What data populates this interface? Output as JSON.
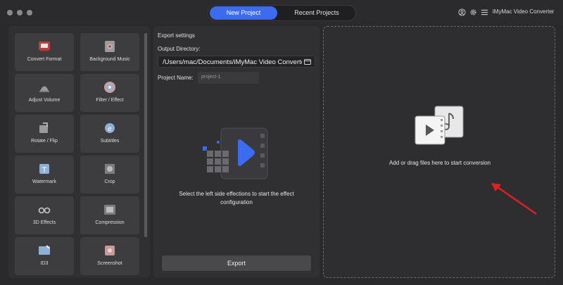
{
  "window": {
    "app_name": "iMyMac Video Converter",
    "tabs": [
      {
        "label": "New Project",
        "active": true
      },
      {
        "label": "Recent Projects",
        "active": false
      }
    ],
    "accent_color": "#3b6cf0"
  },
  "tools": [
    {
      "label": "Convert Format",
      "icon": "convert-format-icon"
    },
    {
      "label": "Background Music",
      "icon": "background-music-icon"
    },
    {
      "label": "Adjust Volume",
      "icon": "adjust-volume-icon"
    },
    {
      "label": "Filter / Effect",
      "icon": "filter-effect-icon"
    },
    {
      "label": "Rotate / Flip",
      "icon": "rotate-flip-icon"
    },
    {
      "label": "Subtitles",
      "icon": "subtitles-icon"
    },
    {
      "label": "Watermark",
      "icon": "watermark-icon"
    },
    {
      "label": "Crop",
      "icon": "crop-icon"
    },
    {
      "label": "3D Effects",
      "icon": "3d-glasses-icon"
    },
    {
      "label": "Compression",
      "icon": "compression-icon"
    },
    {
      "label": "ID3",
      "icon": "id3-icon"
    },
    {
      "label": "Screenshot",
      "icon": "screenshot-icon"
    }
  ],
  "export_settings": {
    "title": "Export settings",
    "output_dir_label": "Output Directory:",
    "output_dir_value": "/Users/mac/Documents/iMyMac Video Converter",
    "project_name_label": "Project Name:",
    "project_name_placeholder": "project-1",
    "hint": "Select the left side effections to start the effect configuration",
    "export_label": "Export"
  },
  "drop_zone": {
    "text": "Add or drag files here to start conversion",
    "arrow_color": "#e02020"
  }
}
